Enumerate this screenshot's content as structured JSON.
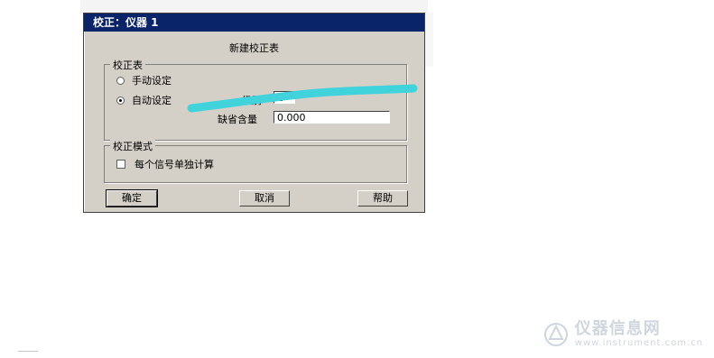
{
  "window": {
    "title": "校正：仪器 1"
  },
  "dialog": {
    "heading": "新建校正表"
  },
  "calibration_table": {
    "group_label": "校正表",
    "manual_label": "手动设定",
    "auto_label": "自动设定",
    "selected_mode": "自动设定",
    "level_label": "级别",
    "level_value": "1",
    "default_amount_label": "缺省含量",
    "default_amount_value": "0.000"
  },
  "calibration_mode": {
    "group_label": "校正模式",
    "checkbox_label": "每个信号单独计算",
    "checked": false
  },
  "buttons": {
    "ok": "确定",
    "cancel": "取消",
    "help": "帮助"
  },
  "annotation": {
    "color": "#41d3dc"
  },
  "watermark": {
    "text": "仪器信息网",
    "url": "www.instrument.com.cn"
  }
}
